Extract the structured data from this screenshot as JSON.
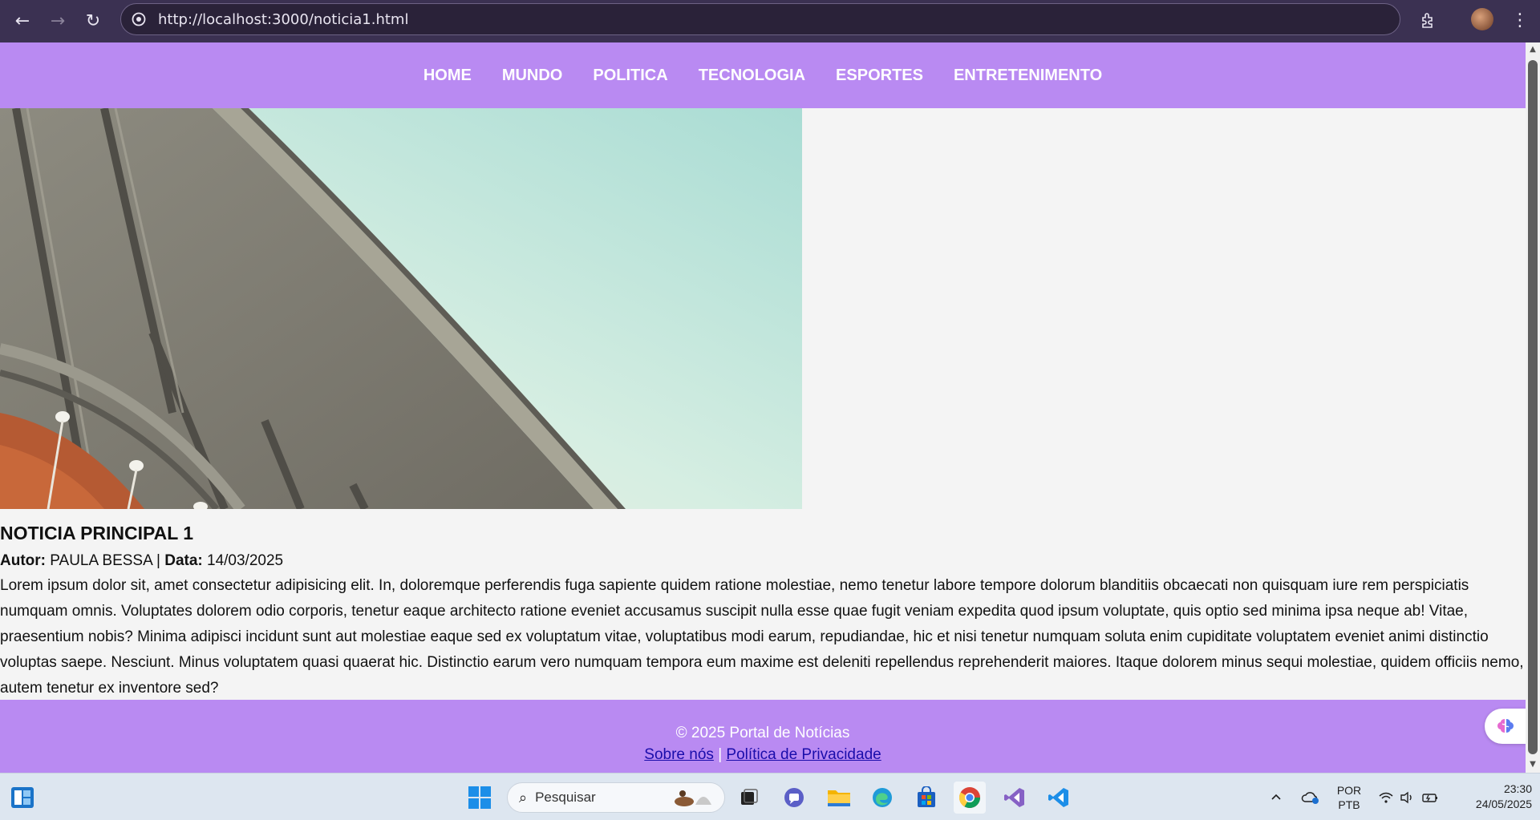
{
  "browser": {
    "url": "http://localhost:3000/noticia1.html"
  },
  "nav": {
    "items": [
      {
        "label": "HOME"
      },
      {
        "label": "MUNDO"
      },
      {
        "label": "POLITICA"
      },
      {
        "label": "TECNOLOGIA"
      },
      {
        "label": "ESPORTES"
      },
      {
        "label": "ENTRETENIMENTO"
      }
    ]
  },
  "article": {
    "title": "NOTICIA PRINCIPAL 1",
    "author_label": "Autor:",
    "author": "PAULA BESSA",
    "separator": "|",
    "date_label": "Data:",
    "date": "14/03/2025",
    "body": "Lorem ipsum dolor sit, amet consectetur adipisicing elit. In, doloremque perferendis fuga sapiente quidem ratione molestiae, nemo tenetur labore tempore dolorum blanditiis obcaecati non quisquam iure rem perspiciatis numquam omnis. Voluptates dolorem odio corporis, tenetur eaque architecto ratione eveniet accusamus suscipit nulla esse quae fugit veniam expedita quod ipsum voluptate, quis optio sed minima ipsa neque ab! Vitae, praesentium nobis? Minima adipisci incidunt sunt aut molestiae eaque sed ex voluptatum vitae, voluptatibus modi earum, repudiandae, hic et nisi tenetur numquam soluta enim cupiditate voluptatem eveniet animi distinctio voluptas saepe. Nesciunt. Minus voluptatem quasi quaerat hic. Distinctio earum vero numquam tempora eum maxime est deleniti repellendus reprehenderit maiores. Itaque dolorem minus sequi molestiae, quidem officiis nemo, autem tenetur ex inventore sed?"
  },
  "footer": {
    "copyright": "© 2025 Portal de Notícias",
    "link_about": "Sobre nós",
    "link_sep": "|",
    "link_privacy": "Política de Privacidade"
  },
  "taskbar": {
    "search_placeholder": "Pesquisar",
    "lang_line1": "POR",
    "lang_line2": "PTB",
    "time": "23:30",
    "date": "24/05/2025"
  },
  "colors": {
    "nav_bg": "#b98af2",
    "browser_bar": "#3b3152",
    "page_bg": "#f4f4f4",
    "link": "#1a0dab"
  },
  "icons": [
    "back-arrow-icon",
    "forward-arrow-icon",
    "reload-icon",
    "site-info-icon",
    "extensions-icon",
    "profile-avatar",
    "more-menu-icon",
    "windows-start-icon",
    "search-icon",
    "task-view-icon",
    "teams-icon",
    "file-explorer-icon",
    "edge-icon",
    "store-icon",
    "chrome-icon",
    "visual-studio-icon",
    "vscode-icon",
    "tray-chevron-icon",
    "onedrive-icon",
    "wifi-icon",
    "volume-icon",
    "battery-icon",
    "copilot-brain-icon"
  ]
}
